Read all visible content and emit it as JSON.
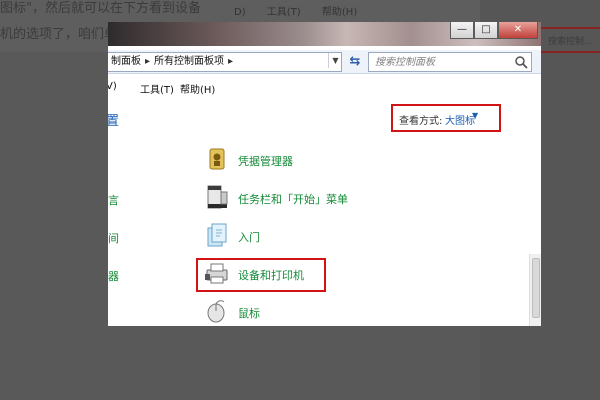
{
  "background": {
    "line1": "图标\"，然后就可以在下方看到设备",
    "line2": "机的选项了，咱们单击进入",
    "menu": [
      "D)",
      "工具(T)",
      "帮助(H)"
    ],
    "search_placeholder": "搜索控制..."
  },
  "window": {
    "buttons": {
      "minimize": "—",
      "maximize": "□",
      "close": "✕"
    },
    "address": {
      "crumbs": [
        "制面板",
        "所有控制面板项"
      ],
      "refresh": "⇆"
    },
    "search": {
      "placeholder": "搜索控制面板"
    },
    "menu": {
      "view": "V)",
      "tools": "工具(T)",
      "help": "帮助(H)"
    },
    "left_link": "置",
    "view_by": {
      "label": "查看方式:",
      "value": "大图标"
    },
    "left_cut": [
      "言",
      "间",
      "器"
    ],
    "items": [
      {
        "label": "凭据管理器",
        "icon": "credential-manager-icon"
      },
      {
        "label": "任务栏和「开始」菜单",
        "icon": "taskbar-icon"
      },
      {
        "label": "入门",
        "icon": "getting-started-icon"
      },
      {
        "label": "设备和打印机",
        "icon": "devices-printers-icon"
      },
      {
        "label": "鼠标",
        "icon": "mouse-icon"
      }
    ]
  },
  "colors": {
    "link_green": "#138a36",
    "link_blue": "#1c5fb0",
    "highlight_red": "#d11313"
  }
}
